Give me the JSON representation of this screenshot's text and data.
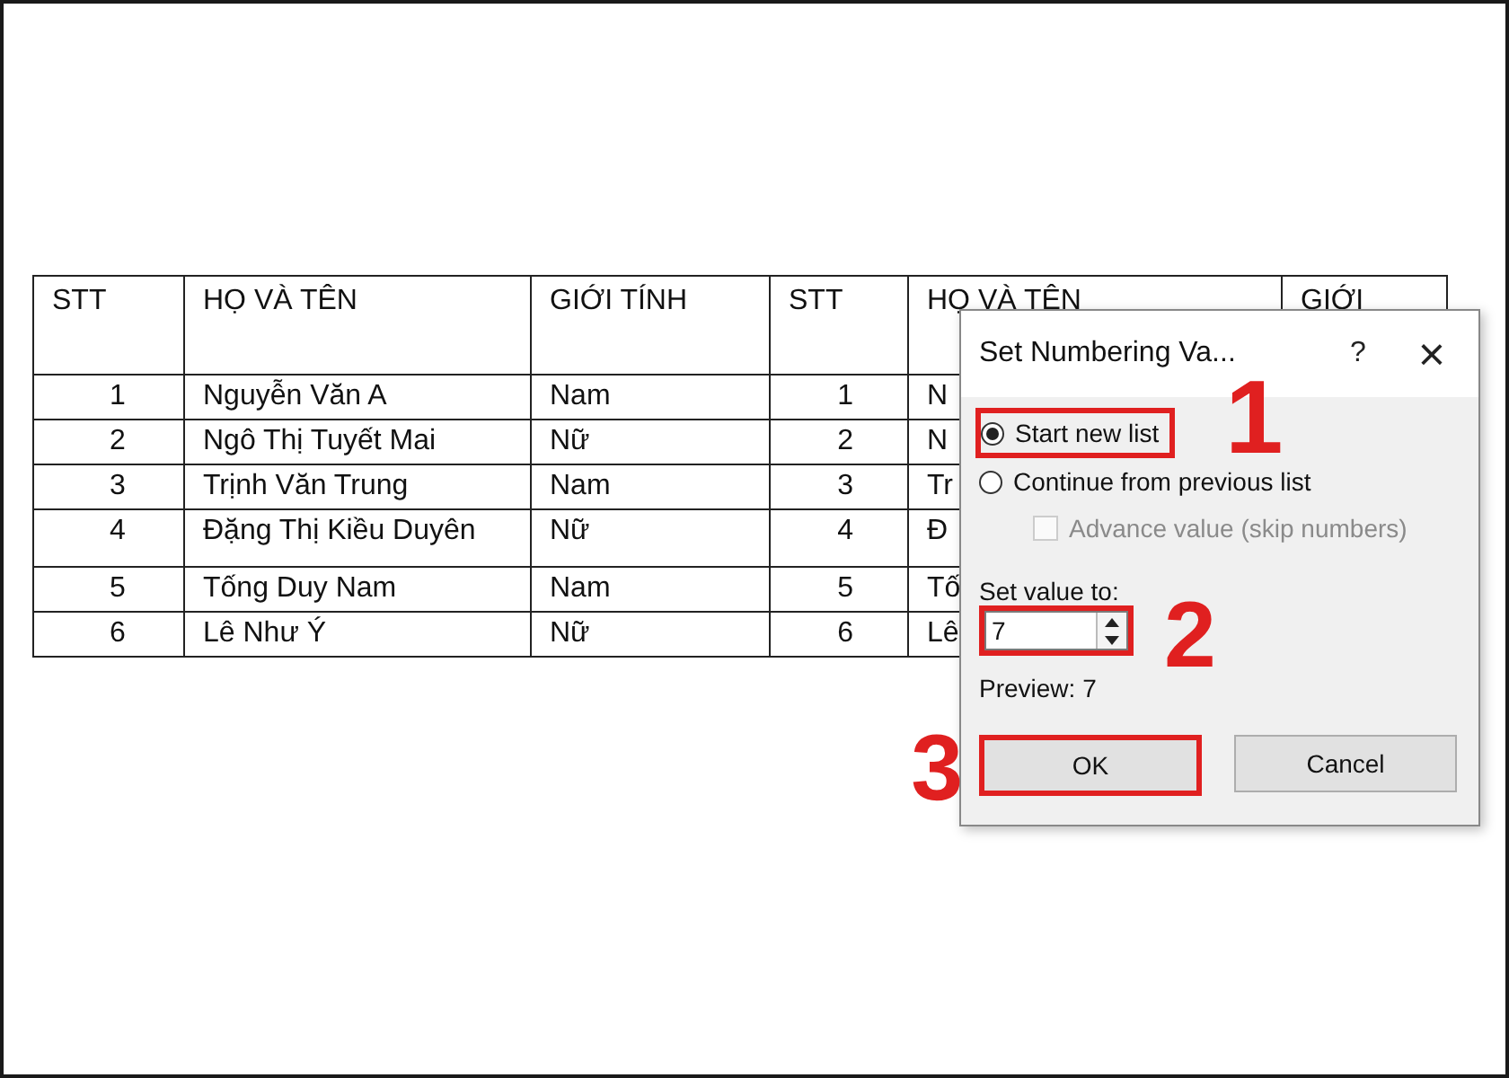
{
  "table": {
    "columns": [
      "STT",
      "HỌ VÀ TÊN",
      "GIỚI TÍNH",
      "STT",
      "HỌ VÀ TÊN",
      "GIỚI"
    ],
    "rows": [
      [
        "1",
        "Nguyễn Văn A",
        "Nam",
        "1",
        "N"
      ],
      [
        "2",
        "Ngô Thị Tuyết Mai",
        "Nữ",
        "2",
        "N"
      ],
      [
        "3",
        "Trịnh Văn Trung",
        "Nam",
        "3",
        "Tr"
      ],
      [
        "4",
        "Đặng Thị Kiều Duyên",
        "Nữ",
        "4",
        "Đ"
      ],
      [
        "5",
        "Tống Duy Nam",
        "Nam",
        "5",
        "Tố"
      ],
      [
        "6",
        "Lê Như Ý",
        "Nữ",
        "6",
        "Lê"
      ]
    ]
  },
  "dialog": {
    "title": "Set Numbering Va...",
    "help": "?",
    "close": "×",
    "options": [
      {
        "kind": "radio",
        "label": "Start new list",
        "selected": true,
        "step": "1"
      },
      {
        "kind": "radio",
        "label": "Continue from previous list",
        "selected": false
      },
      {
        "kind": "checkbox",
        "label": "Advance value (skip numbers)",
        "checked": false,
        "disabled": true
      }
    ],
    "value_label": "Set value to:",
    "value": "7",
    "value_step": "2",
    "preview": "Preview: 7",
    "buttons": [
      {
        "label": "OK",
        "step": "3"
      },
      {
        "label": "Cancel"
      }
    ]
  }
}
